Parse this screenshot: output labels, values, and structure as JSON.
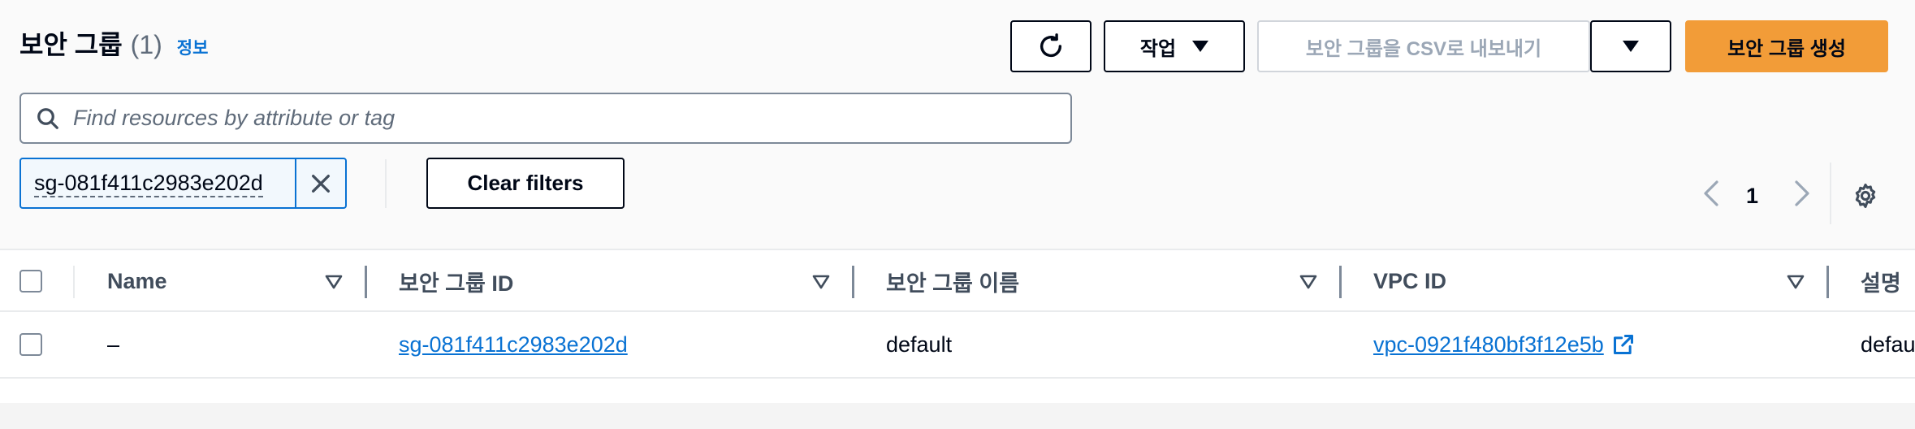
{
  "header": {
    "title": "보안 그룹",
    "count": "(1)",
    "info_link": "정보"
  },
  "toolbar": {
    "refresh_icon": "refresh-icon",
    "actions_label": "작업",
    "export_label": "보안 그룹을 CSV로 내보내기",
    "create_label": "보안 그룹 생성"
  },
  "search": {
    "placeholder": "Find resources by attribute or tag"
  },
  "filter": {
    "token_value": "sg-081f411c2983e202d",
    "clear_label": "Clear filters"
  },
  "pagination": {
    "current_page": "1"
  },
  "table": {
    "columns": [
      "Name",
      "보안 그룹 ID",
      "보안 그룹 이름",
      "VPC ID",
      "설명"
    ],
    "rows": [
      {
        "name": "–",
        "security_group_id": "sg-081f411c2983e202d",
        "security_group_name": "default",
        "vpc_id": "vpc-0921f480bf3f12e5b",
        "description": "defau"
      }
    ]
  },
  "colors": {
    "primary": "#f29c38",
    "link": "#0972d3",
    "text": "#000716"
  }
}
